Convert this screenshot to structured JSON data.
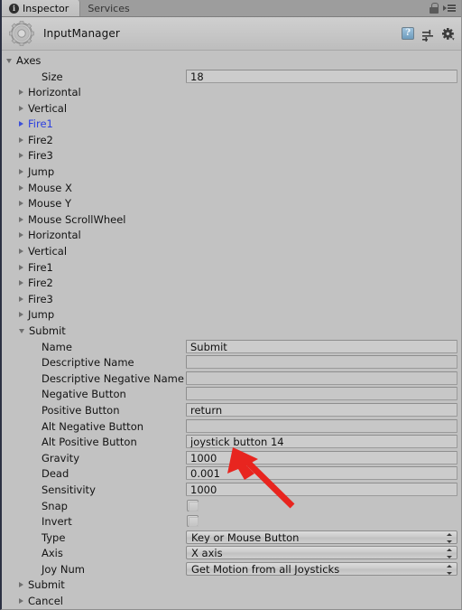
{
  "window": {
    "tabs": [
      {
        "label": "Inspector",
        "icon": "info-icon",
        "active": true
      },
      {
        "label": "Services",
        "icon": null,
        "active": false
      }
    ],
    "lock_icon": "lock-icon",
    "menu_icon": "hamburger-menu-icon"
  },
  "header": {
    "title": "InputManager",
    "asset_icon": "gear-asset-icon",
    "help_label": "?",
    "help_icon": "help-icon",
    "preset_icon": "preset-icon",
    "settings_icon": "gear-icon"
  },
  "inspector": {
    "root": {
      "label": "Axes",
      "expanded": true
    },
    "size": {
      "label": "Size",
      "value": "18"
    },
    "axes": [
      {
        "label": "Horizontal",
        "expanded": false,
        "selected": false
      },
      {
        "label": "Vertical",
        "expanded": false,
        "selected": false
      },
      {
        "label": "Fire1",
        "expanded": false,
        "selected": true
      },
      {
        "label": "Fire2",
        "expanded": false,
        "selected": false
      },
      {
        "label": "Fire3",
        "expanded": false,
        "selected": false
      },
      {
        "label": "Jump",
        "expanded": false,
        "selected": false
      },
      {
        "label": "Mouse X",
        "expanded": false,
        "selected": false
      },
      {
        "label": "Mouse Y",
        "expanded": false,
        "selected": false
      },
      {
        "label": "Mouse ScrollWheel",
        "expanded": false,
        "selected": false
      },
      {
        "label": "Horizontal",
        "expanded": false,
        "selected": false
      },
      {
        "label": "Vertical",
        "expanded": false,
        "selected": false
      },
      {
        "label": "Fire1",
        "expanded": false,
        "selected": false
      },
      {
        "label": "Fire2",
        "expanded": false,
        "selected": false
      },
      {
        "label": "Fire3",
        "expanded": false,
        "selected": false
      },
      {
        "label": "Jump",
        "expanded": false,
        "selected": false
      }
    ],
    "expanded_axis": {
      "label": "Submit",
      "expanded": true
    },
    "properties": [
      {
        "label": "Name",
        "value": "Submit",
        "kind": "text"
      },
      {
        "label": "Descriptive Name",
        "value": "",
        "kind": "text"
      },
      {
        "label": "Descriptive Negative Name",
        "value": "",
        "kind": "text"
      },
      {
        "label": "Negative Button",
        "value": "",
        "kind": "text"
      },
      {
        "label": "Positive Button",
        "value": "return",
        "kind": "text"
      },
      {
        "label": "Alt Negative Button",
        "value": "",
        "kind": "text"
      },
      {
        "label": "Alt Positive Button",
        "value": "joystick button 14",
        "kind": "text"
      },
      {
        "label": "Gravity",
        "value": "1000",
        "kind": "text"
      },
      {
        "label": "Dead",
        "value": "0.001",
        "kind": "text"
      },
      {
        "label": "Sensitivity",
        "value": "1000",
        "kind": "text"
      },
      {
        "label": "Snap",
        "value": false,
        "kind": "checkbox"
      },
      {
        "label": "Invert",
        "value": false,
        "kind": "checkbox"
      },
      {
        "label": "Type",
        "value": "Key or Mouse Button",
        "kind": "dropdown"
      },
      {
        "label": "Axis",
        "value": "X axis",
        "kind": "dropdown"
      },
      {
        "label": "Joy Num",
        "value": "Get Motion from all Joysticks",
        "kind": "dropdown"
      }
    ],
    "trailing_axes": [
      {
        "label": "Submit",
        "expanded": false,
        "selected": false
      },
      {
        "label": "Cancel",
        "expanded": false,
        "selected": false
      }
    ]
  },
  "annotation": {
    "type": "red-arrow",
    "color": "#e8251f",
    "points_at": "Alt Positive Button"
  },
  "colors": {
    "panel_bg": "#c2c2c2",
    "tabbar_bg": "#9d9d9d",
    "selected_text": "#2b3fe0",
    "field_bg": "#cccccc",
    "border_left": "#2b3042"
  }
}
